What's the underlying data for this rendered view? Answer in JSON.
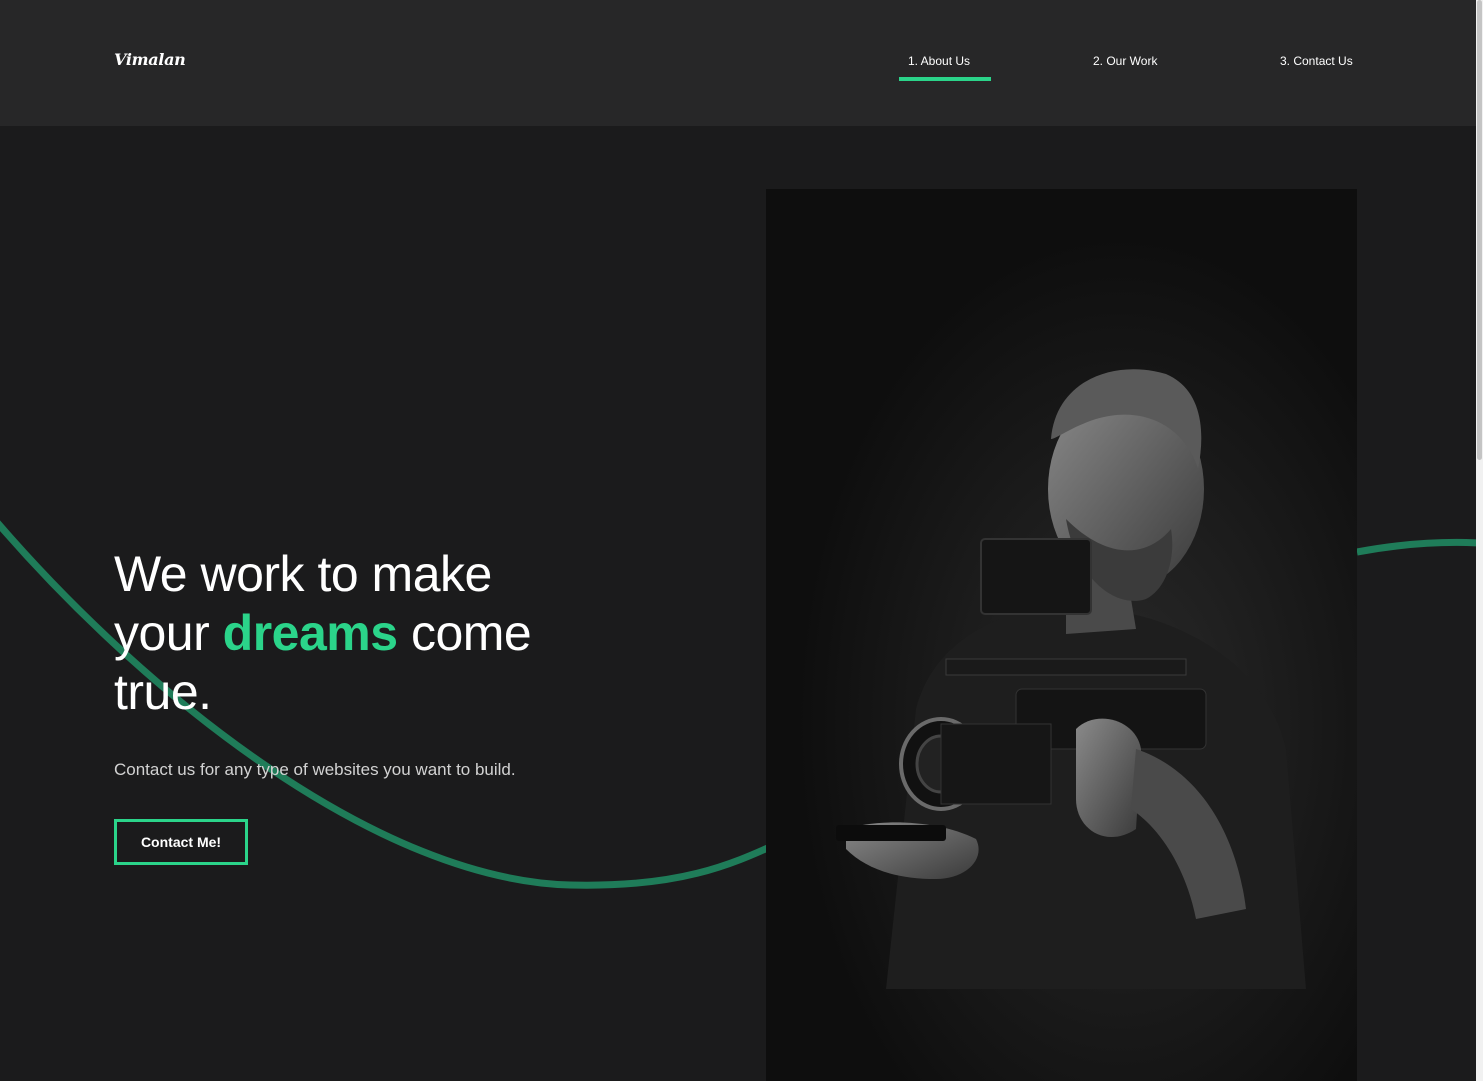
{
  "brand": {
    "logo_text": "Vimalan",
    "accent_color": "#2bd48a",
    "background_color": "#1b1b1c",
    "header_color": "#272728"
  },
  "nav": {
    "items": [
      {
        "label": "1. About Us",
        "active": true
      },
      {
        "label": "2. Our Work",
        "active": false
      },
      {
        "label": "3. Contact Us",
        "active": false
      }
    ]
  },
  "hero": {
    "title_part1": "We work to make your ",
    "title_highlight": "dreams",
    "title_part2": " come true.",
    "subtitle": "Contact us for any type of websites you want to build.",
    "cta_label": "Contact Me!"
  },
  "photo": {
    "icon": "videographer-photo",
    "description_tone": "monochrome"
  }
}
